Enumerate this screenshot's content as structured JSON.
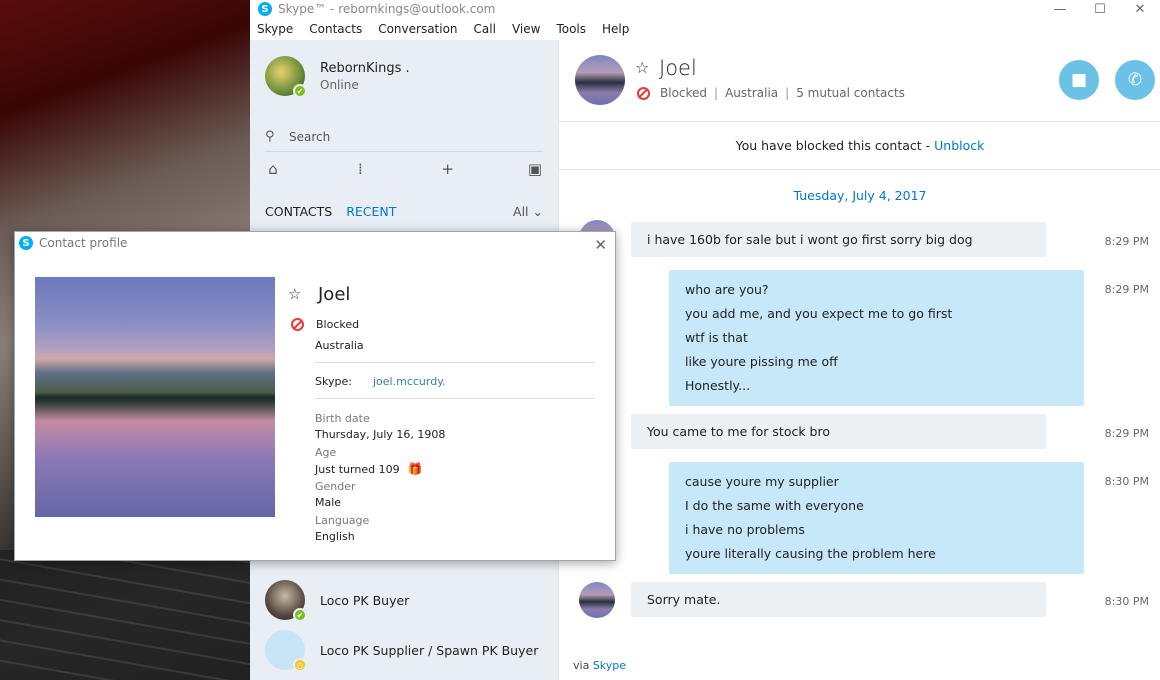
{
  "window": {
    "title": "Skype™ - rebornkings@outlook.com",
    "controls": [
      "minimize",
      "maximize",
      "close"
    ]
  },
  "menu": [
    "Skype",
    "Contacts",
    "Conversation",
    "Call",
    "View",
    "Tools",
    "Help"
  ],
  "sidebar": {
    "profile": {
      "name": "RebornKings .",
      "status": "Online"
    },
    "search_placeholder": "Search",
    "tabs": {
      "contacts": "CONTACTS",
      "recent": "RECENT",
      "filter": "All"
    },
    "contacts": [
      {
        "name": "Loco PK Buyer",
        "status": "online"
      },
      {
        "name": "Loco PK Supplier / Spawn PK Buyer",
        "status": "away"
      }
    ]
  },
  "chat": {
    "contact_name": "Joel",
    "status": "Blocked",
    "location": "Australia",
    "mutual": "5 mutual contacts",
    "blocked_notice": "You have blocked this contact -",
    "unblock_label": "Unblock",
    "date": "Tuesday, July 4, 2017",
    "messages": [
      {
        "dir": "in",
        "lines": [
          "i have 160b for sale but i wont go first sorry big dog"
        ],
        "time": "8:29 PM"
      },
      {
        "dir": "out",
        "lines": [
          "who are you?",
          "you add me, and you expect me to go first",
          "wtf is that",
          "like youre pissing me off",
          "Honestly..."
        ],
        "time": "8:29 PM"
      },
      {
        "dir": "in",
        "lines": [
          "You came to me for stock bro"
        ],
        "time": "8:29 PM"
      },
      {
        "dir": "out",
        "lines": [
          "cause youre my supplier",
          "I do the same with everyone",
          "i have no problems",
          "youre literally causing the problem here"
        ],
        "time": "8:30 PM"
      },
      {
        "dir": "in",
        "lines": [
          "Sorry mate."
        ],
        "time": "8:30 PM"
      }
    ],
    "via_label": "via",
    "via_link": "Skype"
  },
  "profile_dialog": {
    "title": "Contact profile",
    "name": "Joel",
    "status": "Blocked",
    "location": "Australia",
    "skype_label": "Skype:",
    "skype_id": "joel.mccurdy.",
    "birth_label": "Birth date",
    "birth_value": "Thursday, July 16, 1908",
    "age_label": "Age",
    "age_value": "Just turned 109",
    "gender_label": "Gender",
    "gender_value": "Male",
    "language_label": "Language",
    "language_value": "English"
  },
  "colors": {
    "accent": "#0078ca",
    "bubble_out": "#c7e8f8",
    "bubble_in": "#ecf0f3",
    "call_button": "#6cc1e6",
    "online": "#7cbf1e",
    "away": "#f8c31b",
    "blocked": "#e23c3c"
  }
}
